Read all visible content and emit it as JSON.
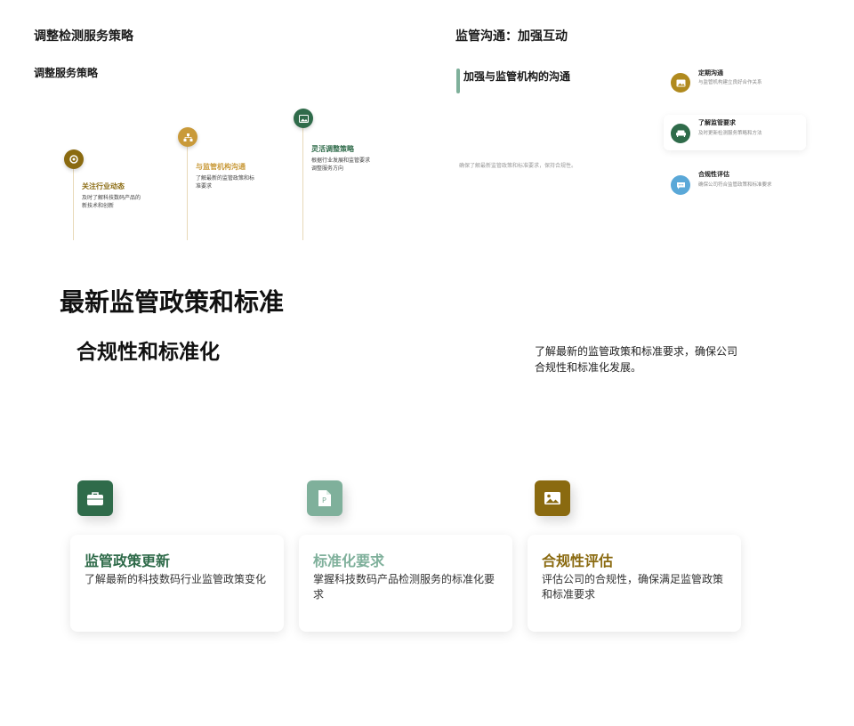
{
  "top_left": {
    "title": "调整检测服务策略",
    "subtitle": "调整服务策略",
    "steps": [
      {
        "title": "关注行业动态",
        "desc": "及时了解科技数码产品的新技术和创新",
        "icon": "target-icon",
        "color": "#8a6a10"
      },
      {
        "title": "与监管机构沟通",
        "desc": "了解最新的监管政策和标准要求",
        "icon": "org-chart-icon",
        "color": "#c99a3a"
      },
      {
        "title": "灵活调整策略",
        "desc": "根据行业发展和监管要求调整服务方向",
        "icon": "image-icon",
        "color": "#2f6b4a"
      }
    ]
  },
  "top_right": {
    "title": "监管沟通：加强互动",
    "heading": "加强与监管机构的沟通",
    "note": "确保了解最新监管政策和标准要求，保持合规性。",
    "items": [
      {
        "title": "定期沟通",
        "desc": "与监管机构建立良好合作关系",
        "icon": "image-icon",
        "color": "#b08a1e"
      },
      {
        "title": "了解监管要求",
        "desc": "及时更新检测服务策略和方法",
        "icon": "couch-icon",
        "color": "#2f6b4a"
      },
      {
        "title": "合规性评估",
        "desc": "确保公司符合监管政策和标准要求",
        "icon": "chat-icon",
        "color": "#5aa8d8"
      }
    ]
  },
  "bottom": {
    "title": "最新监管政策和标准",
    "subtitle": "合规性和标准化",
    "desc": "了解最新的监管政策和标准要求，确保公司合规性和标准化发展。",
    "cards": [
      {
        "title": "监管政策更新",
        "desc": "了解最新的科技数码行业监管政策变化",
        "icon": "briefcase-icon",
        "color": "#2f6b4a"
      },
      {
        "title": "标准化要求",
        "desc": "掌握科技数码产品检测服务的标准化要求",
        "icon": "document-icon",
        "color": "#7fb09b"
      },
      {
        "title": "合规性评估",
        "desc": "评估公司的合规性，确保满足监管政策和标准要求",
        "icon": "image-icon",
        "color": "#8a6a10"
      }
    ]
  }
}
